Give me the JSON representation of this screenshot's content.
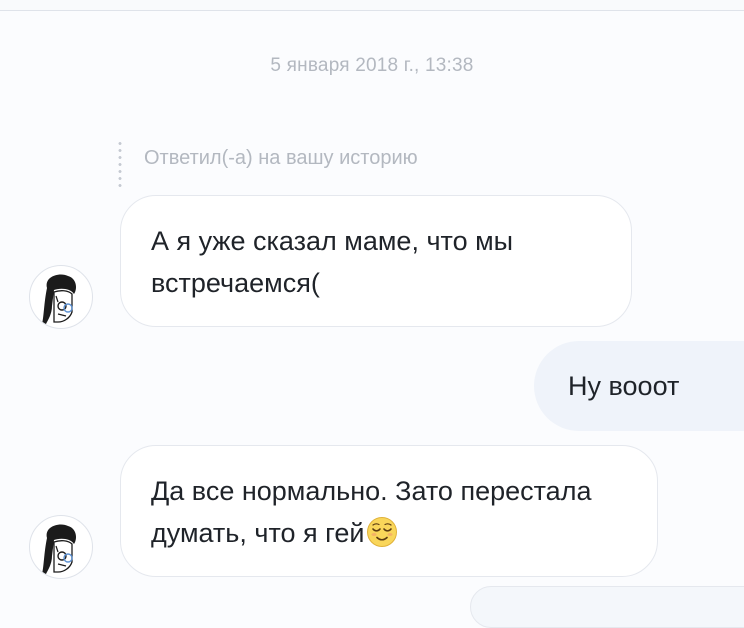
{
  "conversation": {
    "timestamp": "5 января 2018 г., 13:38",
    "reply_context": "Ответил(-а) на вашу историю",
    "messages": [
      {
        "direction": "incoming",
        "text": "А я уже сказал маме, что мы встречаемся("
      },
      {
        "direction": "outgoing",
        "text": "Ну вооот"
      },
      {
        "direction": "incoming",
        "text": "Да все нормально. Зато перестала думать, что я гей",
        "emoji": "relieved-face"
      }
    ]
  },
  "avatar": {
    "icon": "profile-avatar"
  },
  "colors": {
    "incoming_bubble": "#ffffff",
    "outgoing_bubble": "#eff3fa",
    "meta_text": "#b3b8c0",
    "message_text": "#1f2329"
  }
}
